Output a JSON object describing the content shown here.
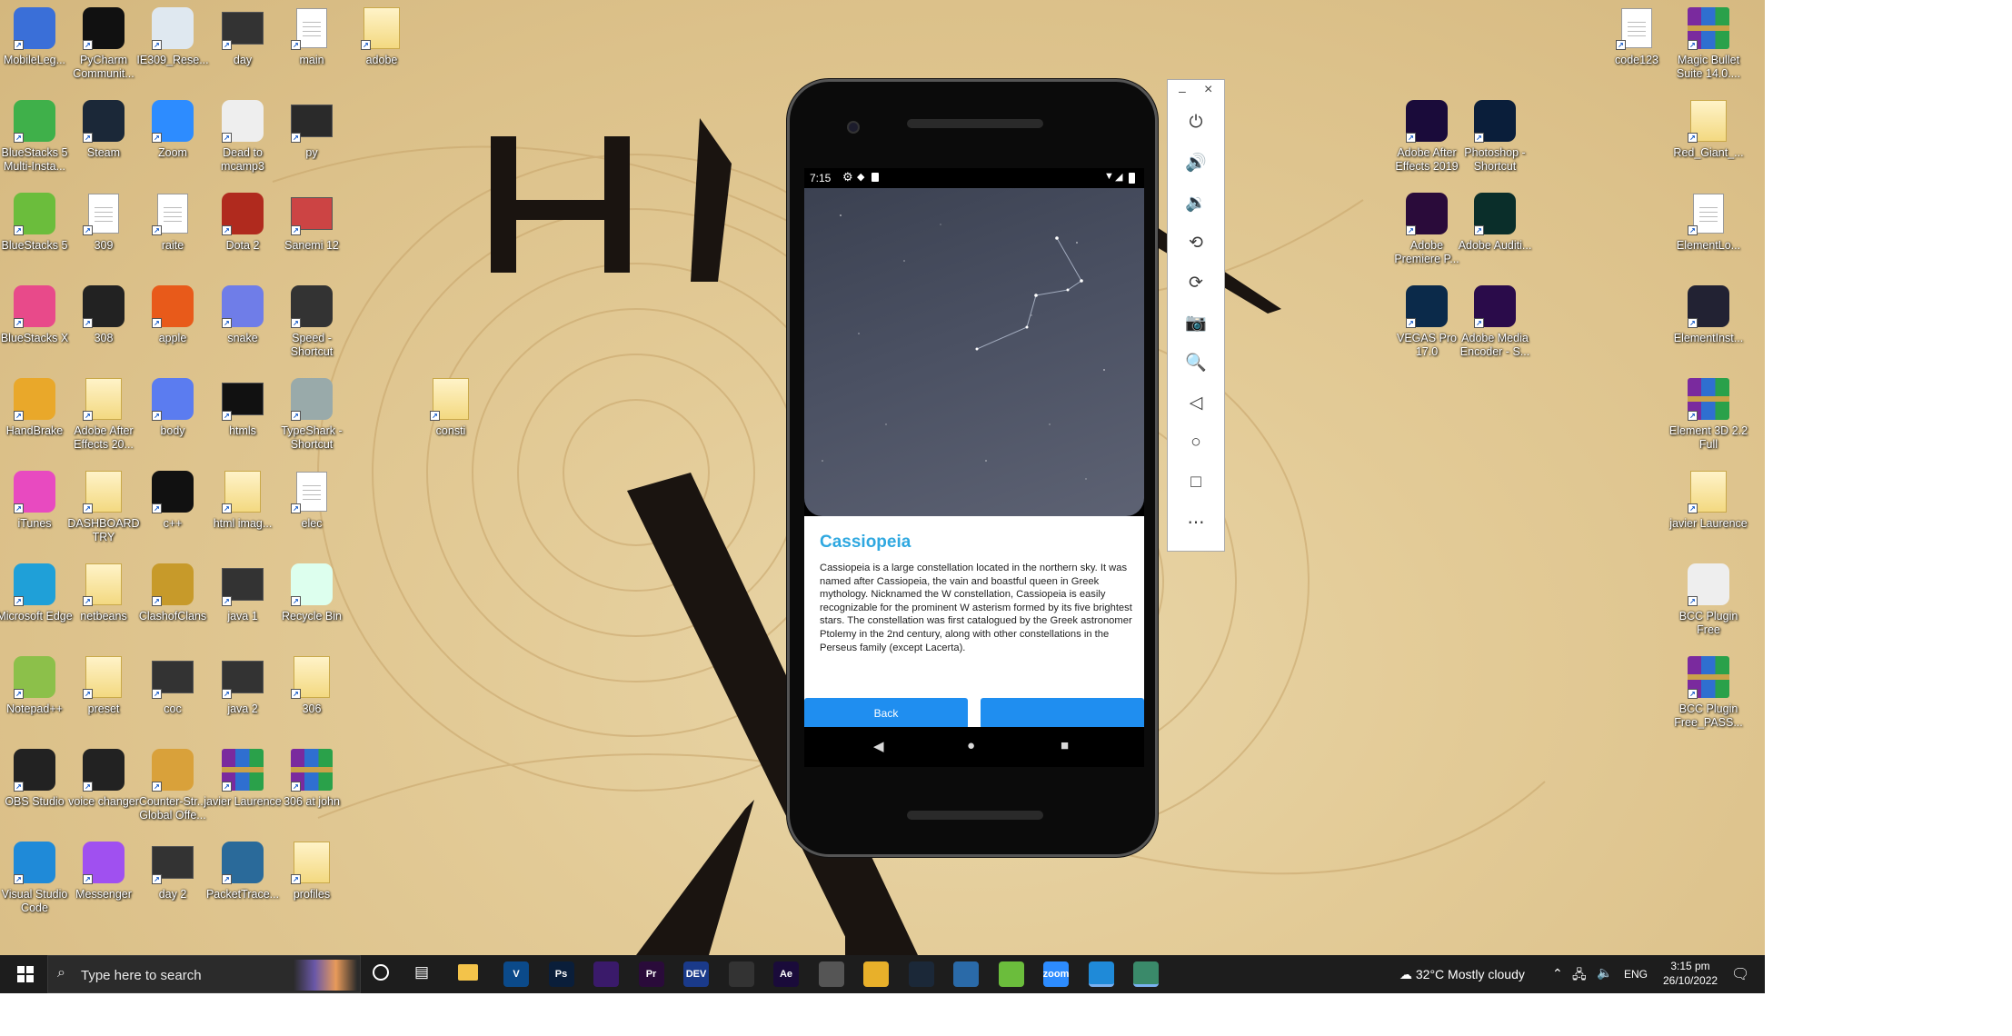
{
  "desktop_icons": [
    {
      "label": "MobileLeg...",
      "icon": "game-icon",
      "color": "#3a6fd8"
    },
    {
      "label": "PyCharm Communit...",
      "icon": "pycharm-icon",
      "color": "#111"
    },
    {
      "label": "IE309_Rese...",
      "icon": "notepad-icon",
      "color": "#dfe8f0"
    },
    {
      "label": "day",
      "icon": "video-thumb-icon",
      "color": "#333"
    },
    {
      "label": "main",
      "icon": "document-icon",
      "color": "#fff"
    },
    {
      "label": "adobe",
      "icon": "folder-icon",
      "color": "#f3d981"
    },
    {
      "label": "BlueStacks 5 Multi-Insta...",
      "icon": "bluestacks-icon",
      "color": "#3fb04a"
    },
    {
      "label": "Steam",
      "icon": "steam-icon",
      "color": "#1b2838"
    },
    {
      "label": "Zoom",
      "icon": "zoom-icon",
      "color": "#2d8cff"
    },
    {
      "label": "Dead to mcamp3",
      "icon": "media-icon",
      "color": "#eee"
    },
    {
      "label": "py",
      "icon": "python-thumb-icon",
      "color": "#2a2a2a"
    },
    {
      "label": "BlueStacks 5",
      "icon": "bluestacks-icon",
      "color": "#6bbd3c"
    },
    {
      "label": "309",
      "icon": "document-icon",
      "color": "#fff"
    },
    {
      "label": "raite",
      "icon": "document-icon",
      "color": "#fff"
    },
    {
      "label": "Dota 2",
      "icon": "dota-icon",
      "color": "#b02a1e"
    },
    {
      "label": "Sanemi 12",
      "icon": "anime-thumb-icon",
      "color": "#c44"
    },
    {
      "label": "BlueStacks X",
      "icon": "bluestacks-x-icon",
      "color": "#e84a8a"
    },
    {
      "label": "308",
      "icon": "book-icon",
      "color": "#222"
    },
    {
      "label": "apple",
      "icon": "apple-icon",
      "color": "#e85a1a"
    },
    {
      "label": "snake",
      "icon": "snake-icon",
      "color": "#6f7de8"
    },
    {
      "label": "Speed - Shortcut",
      "icon": "nfs-icon",
      "color": "#333"
    },
    {
      "label": "HandBrake",
      "icon": "handbrake-icon",
      "color": "#e9a82a"
    },
    {
      "label": "Adobe After Effects 20...",
      "icon": "folder-icon",
      "color": "#f3d981"
    },
    {
      "label": "body",
      "icon": "square-icon",
      "color": "#5b7cf0"
    },
    {
      "label": "htmls",
      "icon": "html-thumb-icon",
      "color": "#111"
    },
    {
      "label": "TypeShark - Shortcut",
      "icon": "shark-icon",
      "color": "#9aa"
    },
    {
      "label": "consti",
      "icon": "folder-icon",
      "color": "#f3d981"
    },
    {
      "label": "iTunes",
      "icon": "itunes-icon",
      "color": "#e84ac0"
    },
    {
      "label": "DASHBOARD TRY",
      "icon": "folder-icon",
      "color": "#f3d981"
    },
    {
      "label": "c++",
      "icon": "cpp-icon",
      "color": "#111"
    },
    {
      "label": "html imag...",
      "icon": "folder-icon",
      "color": "#f3d981"
    },
    {
      "label": "elec",
      "icon": "document-icon",
      "color": "#fff"
    },
    {
      "label": "Microsoft Edge",
      "icon": "edge-icon",
      "color": "#1fa0d8"
    },
    {
      "label": "netbeans",
      "icon": "folder-icon",
      "color": "#f3d981"
    },
    {
      "label": "ClashofClans",
      "icon": "clash-icon",
      "color": "#c79a2a"
    },
    {
      "label": "java 1",
      "icon": "video-thumb-icon",
      "color": "#333"
    },
    {
      "label": "Recycle Bin",
      "icon": "recycle-bin-icon",
      "color": "#dfe"
    },
    {
      "label": "Notepad++",
      "icon": "notepadpp-icon",
      "color": "#8cc04a"
    },
    {
      "label": "preset",
      "icon": "folder-icon",
      "color": "#f3d981"
    },
    {
      "label": "coc",
      "icon": "video-thumb-icon",
      "color": "#333"
    },
    {
      "label": "java 2",
      "icon": "video-thumb-icon",
      "color": "#333"
    },
    {
      "label": "306",
      "icon": "folder-icon",
      "color": "#f3d981"
    },
    {
      "label": "OBS Studio",
      "icon": "obs-icon",
      "color": "#222"
    },
    {
      "label": "voice changer",
      "icon": "voice-changer-icon",
      "color": "#222"
    },
    {
      "label": "Counter-Str... Global Offe...",
      "icon": "csgo-icon",
      "color": "#d9a13a"
    },
    {
      "label": "javier Laurence",
      "icon": "winrar-icon",
      "color": "#7a2a9e"
    },
    {
      "label": "306 at john",
      "icon": "winrar-icon",
      "color": "#7a2a9e"
    },
    {
      "label": "Visual Studio Code",
      "icon": "vscode-icon",
      "color": "#1f8ad8"
    },
    {
      "label": "Messenger",
      "icon": "messenger-icon",
      "color": "#a050f0"
    },
    {
      "label": "day 2",
      "icon": "video-thumb-icon",
      "color": "#333"
    },
    {
      "label": "PacketTrace...",
      "icon": "packet-tracer-icon",
      "color": "#2a6a9a"
    },
    {
      "label": "profiles",
      "icon": "folder-icon",
      "color": "#f3d981"
    },
    {
      "label": "Adobe After Effects 2019",
      "icon": "after-effects-icon",
      "color": "#1a0b3a"
    },
    {
      "label": "Photoshop - Shortcut",
      "icon": "photoshop-icon",
      "color": "#0a1e3a"
    },
    {
      "label": "Adobe Premiere P...",
      "icon": "premiere-icon",
      "color": "#2a0b3a"
    },
    {
      "label": "Adobe Auditi...",
      "icon": "audition-icon",
      "color": "#0a2e2a"
    },
    {
      "label": "VEGAS Pro 17.0",
      "icon": "vegas-icon",
      "color": "#0b2a4a"
    },
    {
      "label": "Adobe Media Encoder - S...",
      "icon": "media-encoder-icon",
      "color": "#2a0b4a"
    },
    {
      "label": "code123",
      "icon": "document-icon",
      "color": "#fff"
    },
    {
      "label": "Magic Bullet Suite 14.0....",
      "icon": "winrar-icon",
      "color": "#7a2a9e"
    },
    {
      "label": "Red_Giant_...",
      "icon": "folder-icon",
      "color": "#f3d981"
    },
    {
      "label": "ElementLo...",
      "icon": "document-icon",
      "color": "#fff"
    },
    {
      "label": "ElementInst...",
      "icon": "element-icon",
      "color": "#223"
    },
    {
      "label": "Element 3D 2.2 Full",
      "icon": "winrar-icon",
      "color": "#7a2a9e"
    },
    {
      "label": "javier Laurence",
      "icon": "folder-icon",
      "color": "#f3d981"
    },
    {
      "label": "BCC Plugin Free",
      "icon": "bcc-icon",
      "color": "#eee"
    },
    {
      "label": "BCC Plugin Free_PASS...",
      "icon": "winrar-icon",
      "color": "#7a2a9e"
    }
  ],
  "phone": {
    "status_time": "7:15",
    "title": "Cassiopeia",
    "description": "Cassiopeia is a large constellation located in the northern sky. It was named after Cassiopeia, the vain and boastful queen in Greek mythology. Nicknamed the W constellation, Cassiopeia is easily recognizable for the prominent W asterism formed by its five brightest stars. The constellation was first catalogued by the Greek astronomer Ptolemy in the 2nd century, along with other constellations in the Perseus family (except Lacerta).",
    "back_label": "Back",
    "second_label": ""
  },
  "toolbar": {
    "minimize": "–",
    "close": "×",
    "tools": [
      "power-icon",
      "volume-up-icon",
      "volume-down-icon",
      "rotate-left-icon",
      "rotate-right-icon",
      "camera-icon",
      "zoom-icon",
      "back-icon",
      "home-icon",
      "overview-icon",
      "more-icon"
    ]
  },
  "taskbar": {
    "search_placeholder": "Type here to search",
    "weather": "32°C  Mostly cloudy",
    "lang": "ENG",
    "time": "3:15 pm",
    "date": "26/10/2022",
    "apps": [
      {
        "name": "vegas",
        "label": "V",
        "color": "#0b4a8a"
      },
      {
        "name": "photoshop",
        "label": "Ps",
        "color": "#0a1e3a"
      },
      {
        "name": "media-encoder",
        "label": "",
        "color": "#3a1a6a"
      },
      {
        "name": "premiere",
        "label": "Pr",
        "color": "#2a0b3a"
      },
      {
        "name": "dev",
        "label": "DEV",
        "color": "#1a3a8a"
      },
      {
        "name": "obs-media",
        "label": "",
        "color": "#333"
      },
      {
        "name": "after-effects",
        "label": "Ae",
        "color": "#1a0b3a"
      },
      {
        "name": "clash",
        "label": "",
        "color": "#555"
      },
      {
        "name": "chrome",
        "label": "",
        "color": "#e8b02a"
      },
      {
        "name": "steam",
        "label": "",
        "color": "#1b2838"
      },
      {
        "name": "packet",
        "label": "",
        "color": "#2a6aa8"
      },
      {
        "name": "bluestacks",
        "label": "",
        "color": "#6bbd3c"
      },
      {
        "name": "zoom",
        "label": "zoom",
        "color": "#2d8cff"
      },
      {
        "name": "vscode",
        "label": "",
        "color": "#1f8ad8"
      },
      {
        "name": "android-studio",
        "label": "",
        "color": "#3a8a6a"
      }
    ]
  }
}
